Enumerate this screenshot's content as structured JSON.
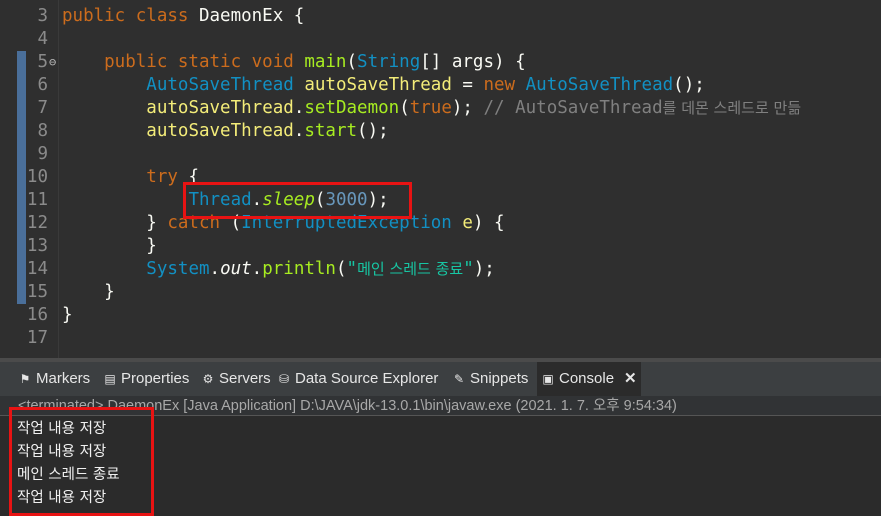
{
  "editor": {
    "lines": [
      {
        "num": "3",
        "tokens": [
          {
            "t": "public class ",
            "c": "kw"
          },
          {
            "t": "DaemonEx",
            "c": "white"
          },
          {
            "t": " {",
            "c": "white"
          }
        ]
      },
      {
        "num": "4",
        "tokens": []
      },
      {
        "num": "5",
        "fold": "⊖",
        "tokens": [
          {
            "t": "    public static void ",
            "c": "kw"
          },
          {
            "t": "main",
            "c": "mth"
          },
          {
            "t": "(",
            "c": "white"
          },
          {
            "t": "String",
            "c": "cls"
          },
          {
            "t": "[] ",
            "c": "white"
          },
          {
            "t": "args",
            "c": "white"
          },
          {
            "t": ") {",
            "c": "white"
          }
        ]
      },
      {
        "num": "6",
        "tokens": [
          {
            "t": "        ",
            "c": "white"
          },
          {
            "t": "AutoSaveThread",
            "c": "cls"
          },
          {
            "t": " ",
            "c": "white"
          },
          {
            "t": "autoSaveThread",
            "c": "var"
          },
          {
            "t": " = ",
            "c": "white"
          },
          {
            "t": "new ",
            "c": "kw"
          },
          {
            "t": "AutoSaveThread",
            "c": "cls"
          },
          {
            "t": "();",
            "c": "white"
          }
        ]
      },
      {
        "num": "7",
        "tokens": [
          {
            "t": "        ",
            "c": "white"
          },
          {
            "t": "autoSaveThread",
            "c": "var"
          },
          {
            "t": ".",
            "c": "white"
          },
          {
            "t": "setDaemon",
            "c": "mth"
          },
          {
            "t": "(",
            "c": "white"
          },
          {
            "t": "true",
            "c": "kw"
          },
          {
            "t": "); ",
            "c": "white"
          },
          {
            "t": "// AutoSaveThread",
            "c": "cmt"
          },
          {
            "t": "를 데몬 스레드로 만듦",
            "c": "cmt ko"
          }
        ]
      },
      {
        "num": "8",
        "tokens": [
          {
            "t": "        ",
            "c": "white"
          },
          {
            "t": "autoSaveThread",
            "c": "var"
          },
          {
            "t": ".",
            "c": "white"
          },
          {
            "t": "start",
            "c": "mth"
          },
          {
            "t": "();",
            "c": "white"
          }
        ]
      },
      {
        "num": "9",
        "tokens": []
      },
      {
        "num": "10",
        "tokens": [
          {
            "t": "        try",
            "c": "kw"
          },
          {
            "t": " {",
            "c": "white"
          }
        ]
      },
      {
        "num": "11",
        "tokens": [
          {
            "t": "            ",
            "c": "white"
          },
          {
            "t": "Thread",
            "c": "cls"
          },
          {
            "t": ".",
            "c": "white"
          },
          {
            "t": "sleep",
            "c": "mth ital"
          },
          {
            "t": "(",
            "c": "white"
          },
          {
            "t": "3000",
            "c": "num"
          },
          {
            "t": ");",
            "c": "white"
          }
        ]
      },
      {
        "num": "12",
        "tokens": [
          {
            "t": "        } ",
            "c": "white"
          },
          {
            "t": "catch",
            "c": "kw"
          },
          {
            "t": " (",
            "c": "white"
          },
          {
            "t": "InterruptedException",
            "c": "cls"
          },
          {
            "t": " ",
            "c": "white"
          },
          {
            "t": "e",
            "c": "var"
          },
          {
            "t": ") {",
            "c": "white"
          }
        ]
      },
      {
        "num": "13",
        "tokens": [
          {
            "t": "        }",
            "c": "white"
          }
        ]
      },
      {
        "num": "14",
        "tokens": [
          {
            "t": "        ",
            "c": "white"
          },
          {
            "t": "System",
            "c": "cls"
          },
          {
            "t": ".",
            "c": "white"
          },
          {
            "t": "out",
            "c": "white ital"
          },
          {
            "t": ".",
            "c": "white"
          },
          {
            "t": "println",
            "c": "mth"
          },
          {
            "t": "(",
            "c": "white"
          },
          {
            "t": "\"",
            "c": "str"
          },
          {
            "t": "메인 스레드 종료",
            "c": "str ko"
          },
          {
            "t": "\"",
            "c": "str"
          },
          {
            "t": ");",
            "c": "white"
          }
        ]
      },
      {
        "num": "15",
        "tokens": [
          {
            "t": "    }",
            "c": "white"
          }
        ]
      },
      {
        "num": "16",
        "tokens": [
          {
            "t": "}",
            "c": "white"
          }
        ]
      },
      {
        "num": "17",
        "tokens": []
      }
    ]
  },
  "tabs": [
    {
      "label": "Markers",
      "icon": "markers-icon",
      "glyph": "⚑"
    },
    {
      "label": "Properties",
      "icon": "properties-icon",
      "glyph": "▤"
    },
    {
      "label": "Servers",
      "icon": "servers-icon",
      "glyph": "⚙"
    },
    {
      "label": "Data Source Explorer",
      "icon": "data-source-icon",
      "glyph": "⛁"
    },
    {
      "label": "Snippets",
      "icon": "snippets-icon",
      "glyph": "✎"
    },
    {
      "label": "Console",
      "icon": "console-icon",
      "glyph": "▣",
      "active": true,
      "close": "✕"
    }
  ],
  "console": {
    "header": "<terminated> DaemonEx [Java Application] D:\\JAVA\\jdk-13.0.1\\bin\\javaw.exe (2021. 1. 7. 오후 9:54:34)",
    "output": [
      "작업 내용 저장",
      "작업 내용 저장",
      "메인 스레드 종료",
      "작업 내용 저장"
    ]
  },
  "colors": {
    "highlight": "#e81313",
    "keyword": "#cc6c1d",
    "class": "#1290c3",
    "method": "#a7ec21",
    "variable": "#f3ec79",
    "string": "#17c6a3",
    "comment": "#808080"
  }
}
